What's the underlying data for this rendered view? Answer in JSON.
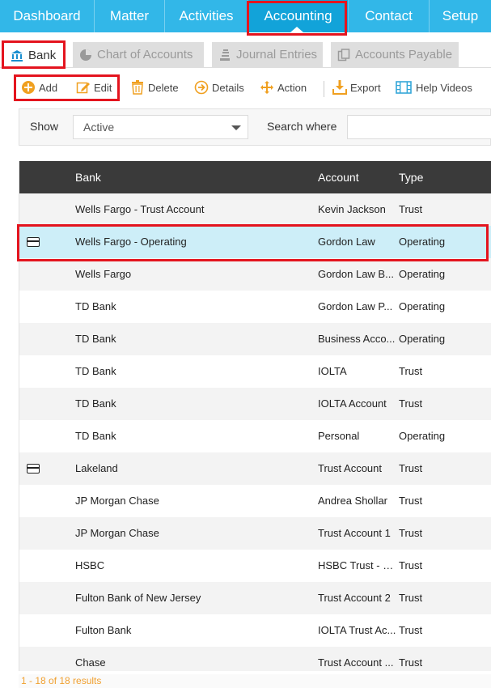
{
  "nav": {
    "items": [
      {
        "label": "Dashboard",
        "active": false
      },
      {
        "label": "Matter",
        "active": false
      },
      {
        "label": "Activities",
        "active": false
      },
      {
        "label": "Accounting",
        "active": true
      },
      {
        "label": "Contact",
        "active": false
      },
      {
        "label": "Setup",
        "active": false
      }
    ]
  },
  "tabs": [
    {
      "label": "Bank",
      "icon": "bank-icon",
      "active": true
    },
    {
      "label": "Chart of Accounts",
      "icon": "pie-chart-icon",
      "active": false
    },
    {
      "label": "Journal Entries",
      "icon": "journal-icon",
      "active": false
    },
    {
      "label": "Accounts Payable",
      "icon": "copy-icon",
      "active": false
    }
  ],
  "toolbar": {
    "add": "Add",
    "edit": "Edit",
    "delete": "Delete",
    "details": "Details",
    "action": "Action",
    "export": "Export",
    "help": "Help Videos"
  },
  "filter": {
    "show_label": "Show",
    "show_value": "Active",
    "search_label": "Search where"
  },
  "table": {
    "headers": {
      "bank": "Bank",
      "account": "Account",
      "type": "Type"
    },
    "rows": [
      {
        "bank": "Wells Fargo - Trust Account",
        "account": "Kevin Jackson",
        "type": "Trust",
        "card": false
      },
      {
        "bank": "Wells Fargo - Operating",
        "account": "Gordon Law",
        "type": "Operating",
        "card": true,
        "selected": true
      },
      {
        "bank": "Wells Fargo",
        "account": "Gordon Law B...",
        "type": "Operating",
        "card": false
      },
      {
        "bank": "TD Bank",
        "account": "Gordon Law P...",
        "type": "Operating",
        "card": false
      },
      {
        "bank": "TD Bank",
        "account": "Business Acco...",
        "type": "Operating",
        "card": false
      },
      {
        "bank": "TD Bank",
        "account": "IOLTA",
        "type": "Trust",
        "card": false
      },
      {
        "bank": "TD Bank",
        "account": "IOLTA Account",
        "type": "Trust",
        "card": false
      },
      {
        "bank": "TD Bank",
        "account": "Personal",
        "type": "Operating",
        "card": false
      },
      {
        "bank": "Lakeland",
        "account": "Trust Account",
        "type": "Trust",
        "card": true
      },
      {
        "bank": "JP Morgan Chase",
        "account": "Andrea Shollar",
        "type": "Trust",
        "card": false
      },
      {
        "bank": "JP Morgan Chase",
        "account": "Trust Account 1",
        "type": "Trust",
        "card": false
      },
      {
        "bank": "HSBC",
        "account": "HSBC Trust - C...",
        "type": "Trust",
        "card": false
      },
      {
        "bank": "Fulton Bank of New Jersey",
        "account": "Trust Account 2",
        "type": "Trust",
        "card": false
      },
      {
        "bank": "Fulton Bank",
        "account": "IOLTA Trust Ac...",
        "type": "Trust",
        "card": false
      },
      {
        "bank": "Chase",
        "account": "Trust Account ...",
        "type": "Trust",
        "card": false
      }
    ]
  },
  "footer": {
    "results": "1 - 18 of 18 results"
  },
  "colors": {
    "nav_bg": "#32b7e8",
    "nav_active": "#12a3d9",
    "header_bg": "#3a3a3a",
    "selected_row": "#cdeef8",
    "highlight": "#e4141e",
    "toolbar_icon": "#f0a020"
  }
}
